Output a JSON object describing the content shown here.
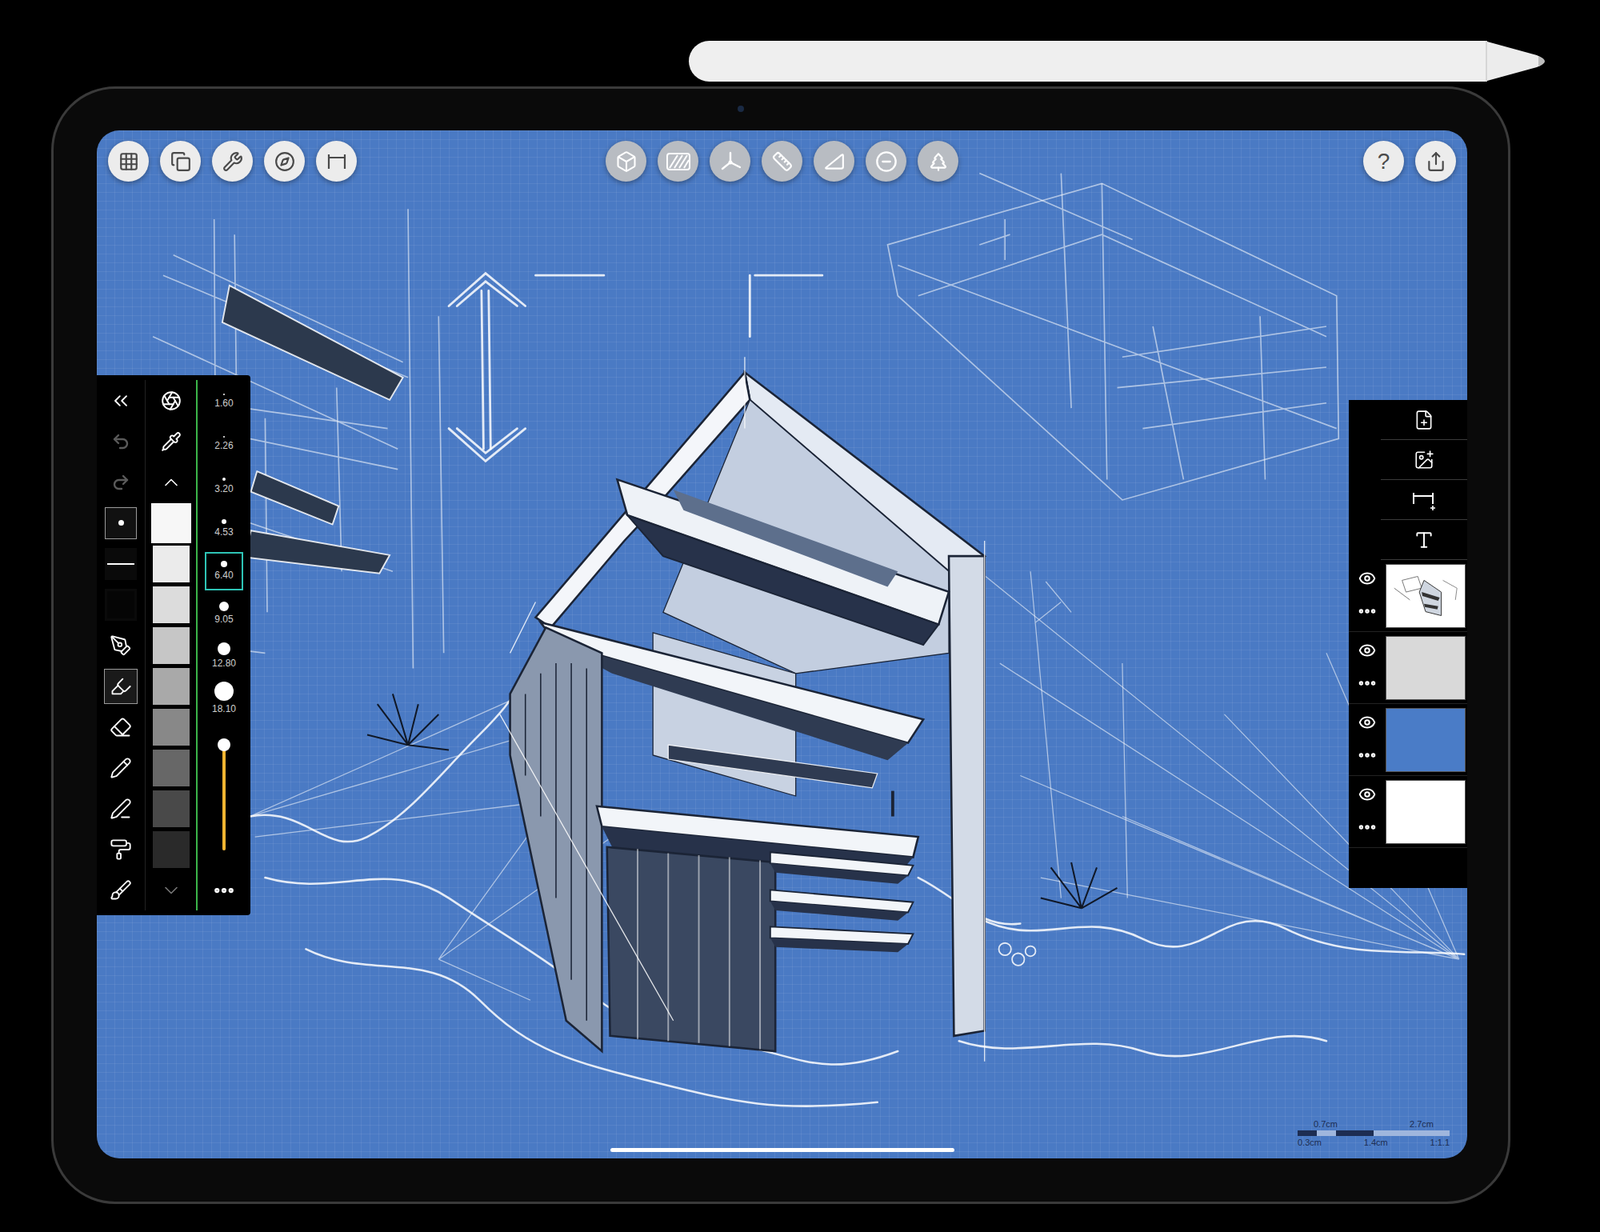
{
  "top_toolbar": {
    "help": "?"
  },
  "brush_panel": {
    "undo": {
      "disabled": true
    },
    "redo": {
      "disabled": true
    },
    "tips": [
      {
        "kind": "dot",
        "selected": true
      },
      {
        "kind": "line",
        "selected": false
      },
      {
        "kind": "blank",
        "selected": false
      }
    ],
    "tools": [
      {
        "kind": "technical-pen",
        "selected": false
      },
      {
        "kind": "marker",
        "selected": true
      },
      {
        "kind": "eraser",
        "selected": false
      },
      {
        "kind": "pencil",
        "selected": false
      },
      {
        "kind": "fountain-pen",
        "selected": false
      },
      {
        "kind": "roller",
        "selected": false
      },
      {
        "kind": "brush-marker",
        "selected": false
      }
    ],
    "swatches": [
      {
        "color": "#f7f7f7",
        "selected": true
      },
      {
        "color": "#ebebeb",
        "selected": false
      },
      {
        "color": "#dcdcdc",
        "selected": false
      },
      {
        "color": "#c6c6c6",
        "selected": false
      },
      {
        "color": "#a9a9a9",
        "selected": false
      },
      {
        "color": "#888888",
        "selected": false
      },
      {
        "color": "#676767",
        "selected": false
      },
      {
        "color": "#494949",
        "selected": false
      },
      {
        "color": "#2a2a2a",
        "selected": false
      }
    ],
    "sizes": [
      {
        "label": "1.60",
        "selected": false
      },
      {
        "label": "2.26",
        "selected": false
      },
      {
        "label": "3.20",
        "selected": false
      },
      {
        "label": "4.53",
        "selected": false
      },
      {
        "label": "6.40",
        "selected": true
      },
      {
        "label": "9.05",
        "selected": false
      },
      {
        "label": "12.80",
        "selected": false
      },
      {
        "label": "18.10",
        "selected": false
      }
    ],
    "opacity": {
      "level": 0.94
    }
  },
  "layers": [
    {
      "kind": "sketch",
      "visible": true,
      "color": "#ffffff"
    },
    {
      "kind": "fill",
      "visible": true,
      "color": "#d9d9d9"
    },
    {
      "kind": "fill",
      "visible": true,
      "color": "#4a7cc7"
    },
    {
      "kind": "fill",
      "visible": true,
      "color": "#ffffff"
    }
  ],
  "scale_bar": {
    "top": [
      "0.7cm",
      "2.7cm"
    ],
    "bottom": [
      "0.3cm",
      "1.4cm",
      "1:1.1"
    ]
  }
}
